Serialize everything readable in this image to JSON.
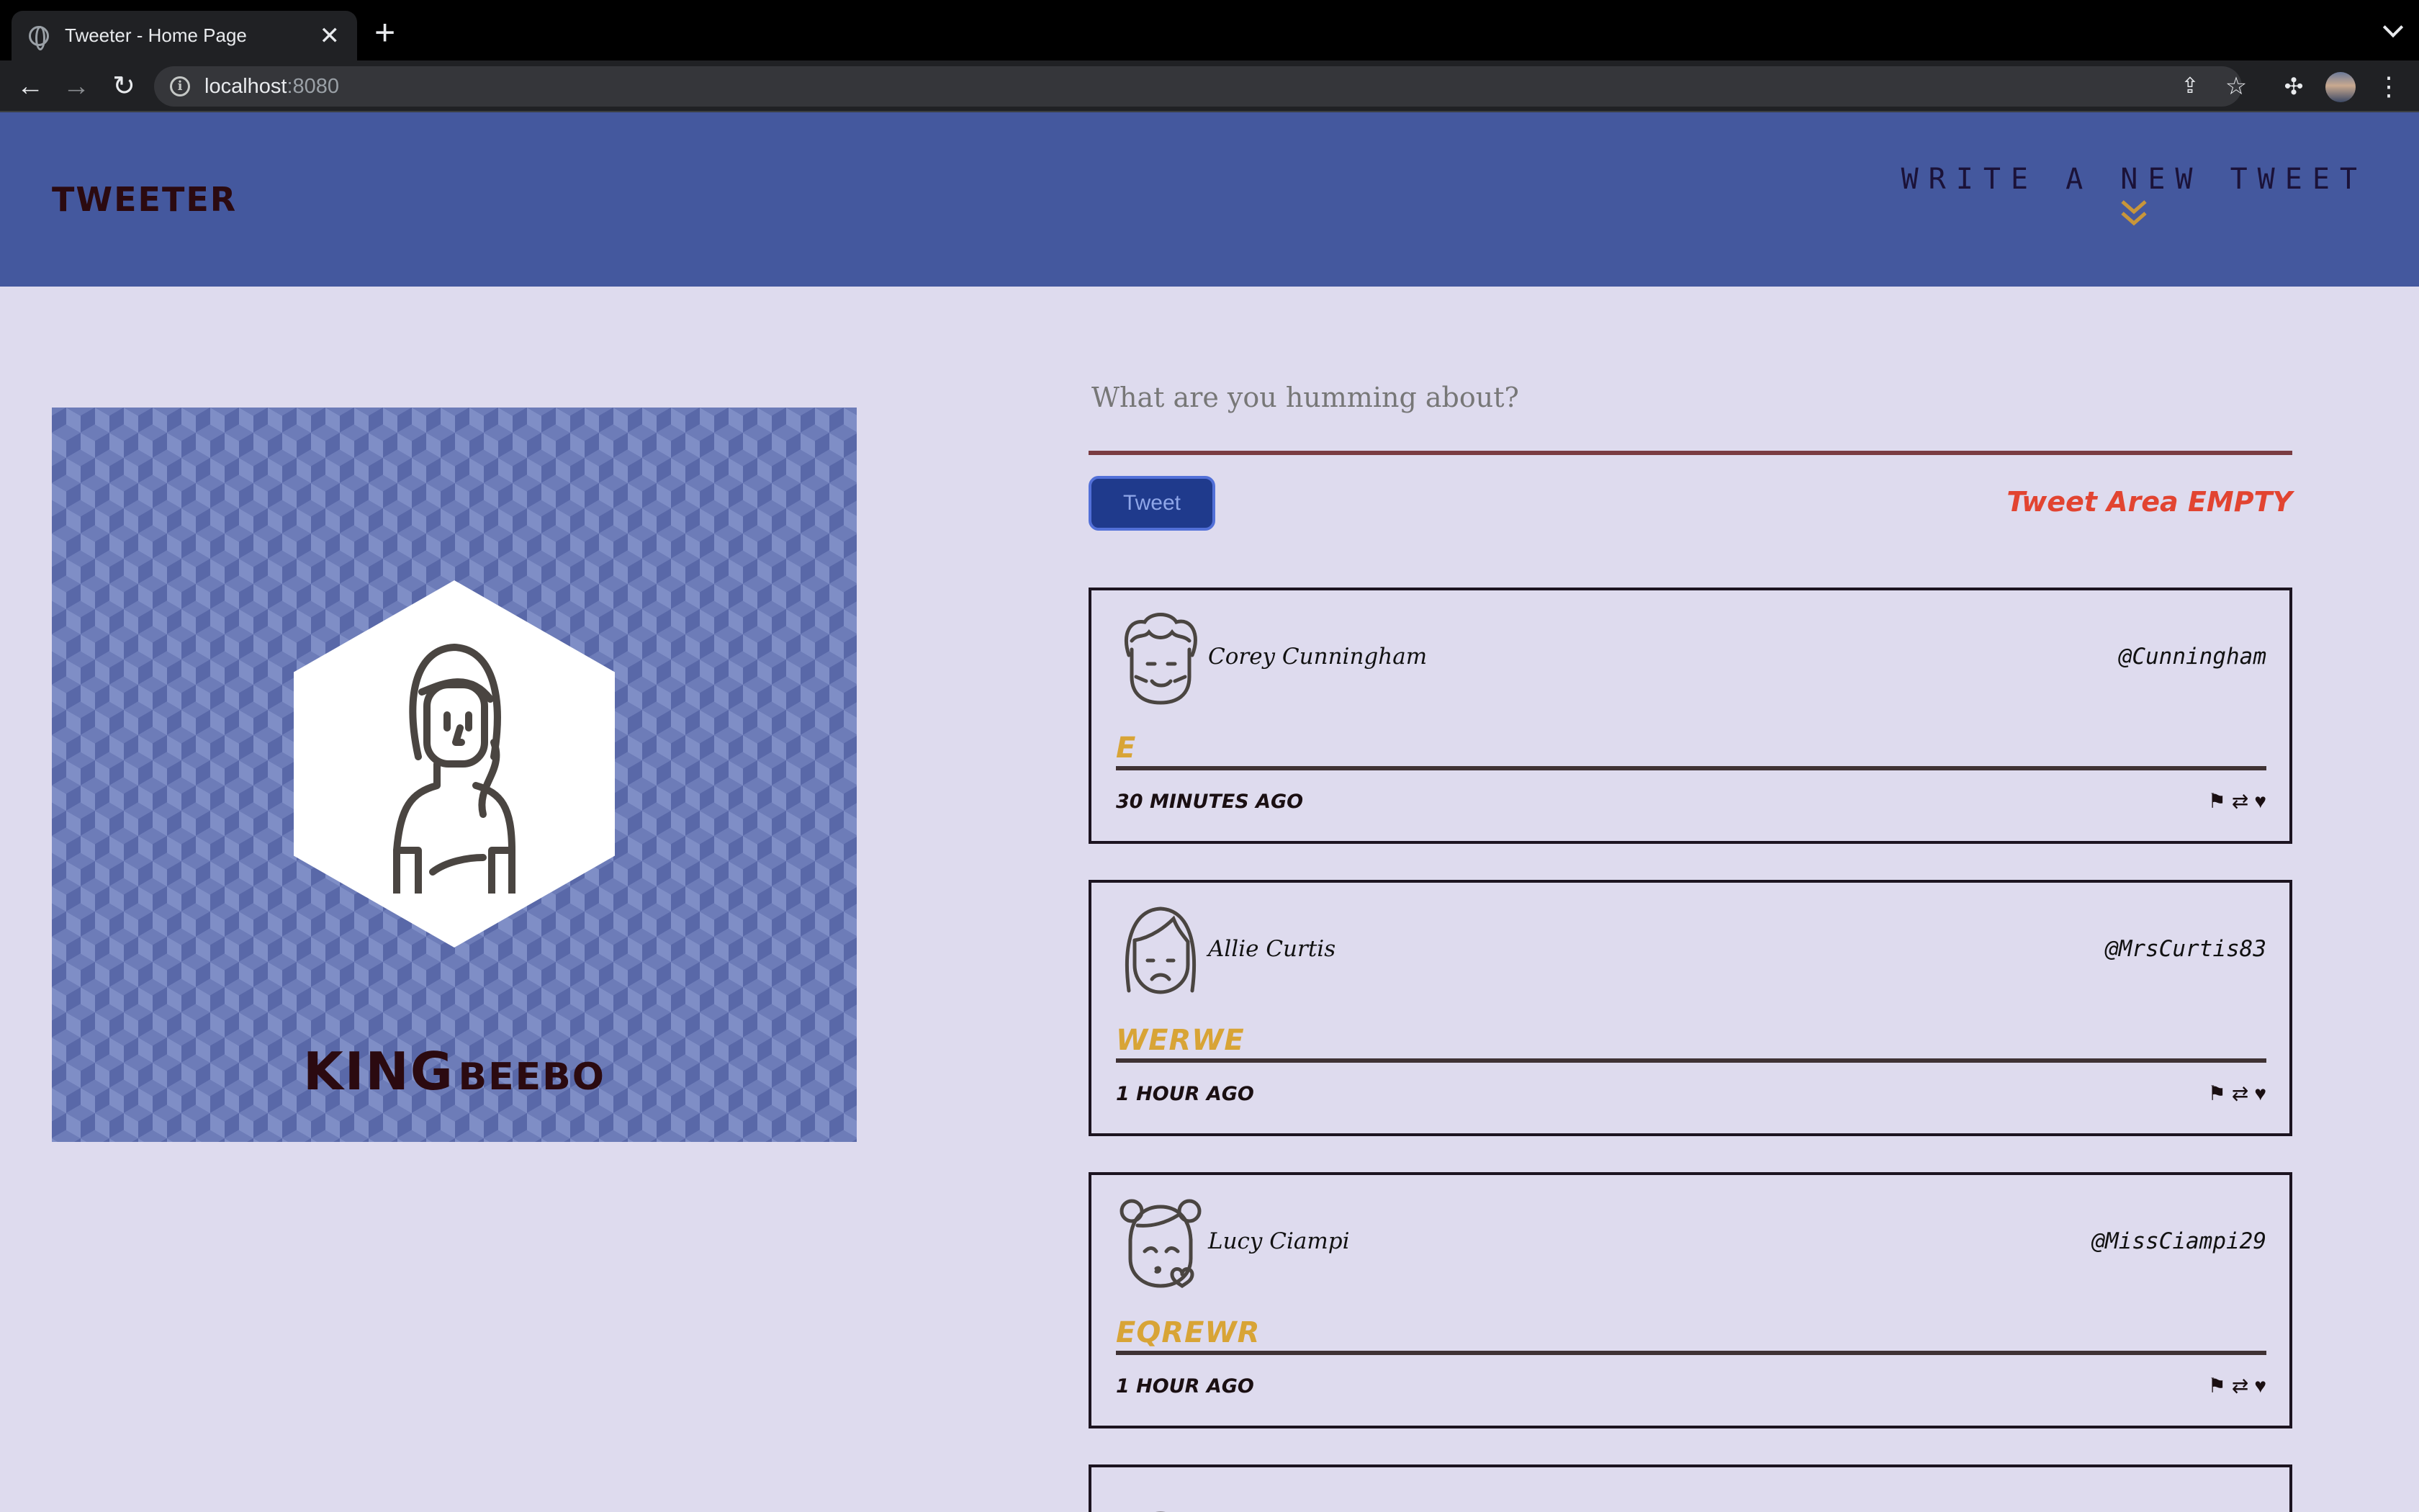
{
  "browser": {
    "tab_title": "Tweeter - Home Page",
    "tab_close": "✕",
    "new_tab": "+",
    "url_host": "localhost",
    "url_port": ":8080"
  },
  "header": {
    "brand": "TWEETER",
    "write_tweet_label": "WRITE A NEW TWEET",
    "write_tweet_icon": "double-chevron-down-icon"
  },
  "profile": {
    "first_name": "KING",
    "last_name": "BEEBO"
  },
  "composer": {
    "placeholder": "What are you humming about?",
    "value": "",
    "button_label": "Tweet",
    "error_message": "Tweet Area EMPTY"
  },
  "tweets": [
    {
      "name": "Corey Cunningham",
      "handle": "@Cunningham",
      "content": "E",
      "time": "30 MINUTES AGO",
      "avatar": "curly-hair-man-avatar"
    },
    {
      "name": "Allie Curtis",
      "handle": "@MrsCurtis83",
      "content": "WERWE",
      "time": "1 HOUR AGO",
      "avatar": "woman-avatar"
    },
    {
      "name": "Lucy Ciampi",
      "handle": "@MissCiampi29",
      "content": "EQREWR",
      "time": "1 HOUR AGO",
      "avatar": "kissing-girl-avatar"
    }
  ],
  "actions": {
    "flag": "⚑",
    "retweet": "⇄",
    "like": "♥"
  },
  "colors": {
    "header_bg": "#44589e",
    "page_bg": "#dedbee",
    "accent_gold": "#d8a436",
    "error_red": "#e24431",
    "brand_dark": "#2b0a10"
  }
}
